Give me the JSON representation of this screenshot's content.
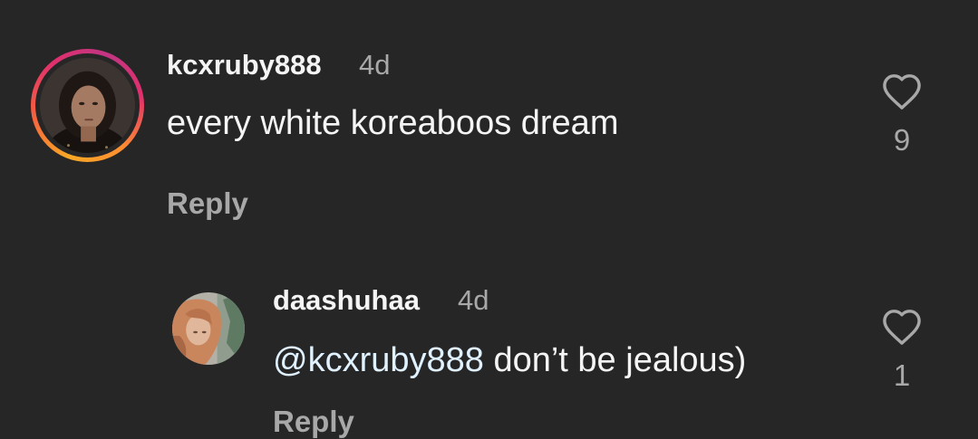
{
  "comments": [
    {
      "username": "kcxruby888",
      "time": "4d",
      "text": "every white koreaboos dream",
      "like_count": "9",
      "reply_label": "Reply",
      "has_story_ring": true
    }
  ],
  "replies": [
    {
      "username": "daashuhaa",
      "time": "4d",
      "mention": "@kcxruby888",
      "text": " don’t be jealous)",
      "like_count": "1",
      "reply_label": "Reply"
    }
  ],
  "icons": {
    "like": "heart-outline-icon"
  },
  "colors": {
    "background": "#262626",
    "primary_text": "#f5f5f5",
    "secondary_text": "#a8a8a8",
    "mention": "#e0f1ff",
    "story_ring": [
      "#f9a825",
      "#e1306c",
      "#c13584"
    ]
  }
}
